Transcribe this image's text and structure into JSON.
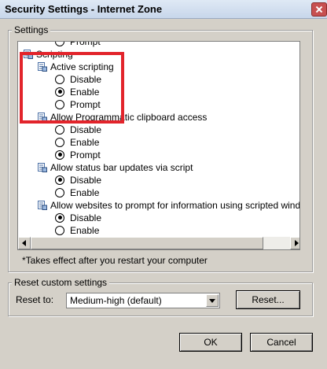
{
  "window": {
    "title": "Security Settings - Internet Zone"
  },
  "settings_group": {
    "label": "Settings"
  },
  "settings_list": [
    {
      "kind": "option",
      "label": "Prompt",
      "selected": false
    },
    {
      "kind": "category",
      "label": "Scripting",
      "icon": "settings-category-icon"
    },
    {
      "kind": "setting",
      "label": "Active scripting",
      "icon": "setting-icon"
    },
    {
      "kind": "option",
      "label": "Disable",
      "selected": false
    },
    {
      "kind": "option",
      "label": "Enable",
      "selected": true
    },
    {
      "kind": "option",
      "label": "Prompt",
      "selected": false
    },
    {
      "kind": "setting",
      "label": "Allow Programmatic clipboard access",
      "icon": "setting-icon"
    },
    {
      "kind": "option",
      "label": "Disable",
      "selected": false
    },
    {
      "kind": "option",
      "label": "Enable",
      "selected": false
    },
    {
      "kind": "option",
      "label": "Prompt",
      "selected": true
    },
    {
      "kind": "setting",
      "label": "Allow status bar updates via script",
      "icon": "setting-icon"
    },
    {
      "kind": "option",
      "label": "Disable",
      "selected": true
    },
    {
      "kind": "option",
      "label": "Enable",
      "selected": false
    },
    {
      "kind": "setting",
      "label": "Allow websites to prompt for information using scripted windows",
      "icon": "setting-icon"
    },
    {
      "kind": "option",
      "label": "Disable",
      "selected": true
    },
    {
      "kind": "option",
      "label": "Enable",
      "selected": false
    }
  ],
  "note": "*Takes effect after you restart your computer",
  "reset_group": {
    "label": "Reset custom settings",
    "reset_to_label": "Reset to:",
    "selected_level": "Medium-high (default)",
    "reset_button": "Reset..."
  },
  "footer": {
    "ok": "OK",
    "cancel": "Cancel"
  },
  "colors": {
    "annotation": "#e2242b",
    "dialog_bg": "#d4d0c8"
  }
}
